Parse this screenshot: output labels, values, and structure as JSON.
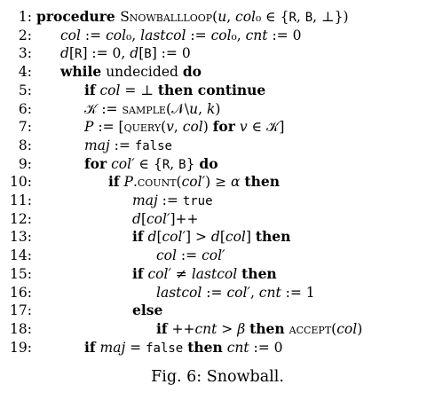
{
  "algorithm": {
    "lines": [
      {
        "num": "1:",
        "indent": 0,
        "segments": [
          {
            "t": "procedure ",
            "s": "kw"
          },
          {
            "t": "Snowballloop",
            "s": "sc"
          },
          {
            "t": "(",
            "s": ""
          },
          {
            "t": "u",
            "s": "it"
          },
          {
            "t": ", ",
            "s": ""
          },
          {
            "t": "col",
            "s": "it"
          },
          {
            "t": "₀ ∈ {",
            "s": ""
          },
          {
            "t": "R",
            "s": "tt"
          },
          {
            "t": ", ",
            "s": ""
          },
          {
            "t": "B",
            "s": "tt"
          },
          {
            "t": ", ⊥})",
            "s": ""
          }
        ]
      },
      {
        "num": "2:",
        "indent": 1,
        "segments": [
          {
            "t": "col",
            "s": "it"
          },
          {
            "t": " := ",
            "s": ""
          },
          {
            "t": "col",
            "s": "it"
          },
          {
            "t": "₀, ",
            "s": ""
          },
          {
            "t": "lastcol",
            "s": "it"
          },
          {
            "t": " := ",
            "s": ""
          },
          {
            "t": "col",
            "s": "it"
          },
          {
            "t": "₀, ",
            "s": ""
          },
          {
            "t": "cnt",
            "s": "it"
          },
          {
            "t": " := 0",
            "s": ""
          }
        ]
      },
      {
        "num": "3:",
        "indent": 1,
        "segments": [
          {
            "t": "d",
            "s": "it"
          },
          {
            "t": "[",
            "s": ""
          },
          {
            "t": "R",
            "s": "tt"
          },
          {
            "t": "] := 0, ",
            "s": ""
          },
          {
            "t": "d",
            "s": "it"
          },
          {
            "t": "[",
            "s": ""
          },
          {
            "t": "B",
            "s": "tt"
          },
          {
            "t": "] := 0",
            "s": ""
          }
        ]
      },
      {
        "num": "4:",
        "indent": 1,
        "segments": [
          {
            "t": "while",
            "s": "kw"
          },
          {
            "t": " undecided ",
            "s": ""
          },
          {
            "t": "do",
            "s": "kw"
          }
        ]
      },
      {
        "num": "5:",
        "indent": 2,
        "segments": [
          {
            "t": "if",
            "s": "kw"
          },
          {
            "t": " ",
            "s": ""
          },
          {
            "t": "col",
            "s": "it"
          },
          {
            "t": " = ⊥ ",
            "s": ""
          },
          {
            "t": "then continue",
            "s": "kw"
          }
        ]
      },
      {
        "num": "6:",
        "indent": 2,
        "segments": [
          {
            "t": "𝒦",
            "s": ""
          },
          {
            "t": " := ",
            "s": ""
          },
          {
            "t": "sample",
            "s": "sc"
          },
          {
            "t": "(𝒩\\",
            "s": ""
          },
          {
            "t": "u",
            "s": "it"
          },
          {
            "t": ", ",
            "s": ""
          },
          {
            "t": "k",
            "s": "it"
          },
          {
            "t": ")",
            "s": ""
          }
        ]
      },
      {
        "num": "7:",
        "indent": 2,
        "segments": [
          {
            "t": "P",
            "s": "it"
          },
          {
            "t": " := [",
            "s": ""
          },
          {
            "t": "query",
            "s": "sc"
          },
          {
            "t": "(",
            "s": ""
          },
          {
            "t": "v",
            "s": "it"
          },
          {
            "t": ", ",
            "s": ""
          },
          {
            "t": "col",
            "s": "it"
          },
          {
            "t": ")   ",
            "s": ""
          },
          {
            "t": "for",
            "s": "kw"
          },
          {
            "t": " ",
            "s": ""
          },
          {
            "t": "v",
            "s": "it"
          },
          {
            "t": " ∈ 𝒦]",
            "s": ""
          }
        ]
      },
      {
        "num": "8:",
        "indent": 2,
        "segments": [
          {
            "t": "maj",
            "s": "it"
          },
          {
            "t": " := ",
            "s": ""
          },
          {
            "t": "false",
            "s": "tt"
          }
        ]
      },
      {
        "num": "9:",
        "indent": 2,
        "segments": [
          {
            "t": "for",
            "s": "kw"
          },
          {
            "t": " ",
            "s": ""
          },
          {
            "t": "col′",
            "s": "it"
          },
          {
            "t": " ∈ {",
            "s": ""
          },
          {
            "t": "R",
            "s": "tt"
          },
          {
            "t": ", ",
            "s": ""
          },
          {
            "t": "B",
            "s": "tt"
          },
          {
            "t": "} ",
            "s": ""
          },
          {
            "t": "do",
            "s": "kw"
          }
        ]
      },
      {
        "num": "10:",
        "indent": 3,
        "segments": [
          {
            "t": "if",
            "s": "kw"
          },
          {
            "t": " ",
            "s": ""
          },
          {
            "t": "P",
            "s": "it"
          },
          {
            "t": ".",
            "s": ""
          },
          {
            "t": "count",
            "s": "sc"
          },
          {
            "t": "(",
            "s": ""
          },
          {
            "t": "col′",
            "s": "it"
          },
          {
            "t": ") ≥ ",
            "s": ""
          },
          {
            "t": "α",
            "s": "it"
          },
          {
            "t": " ",
            "s": ""
          },
          {
            "t": "then",
            "s": "kw"
          }
        ]
      },
      {
        "num": "11:",
        "indent": 4,
        "segments": [
          {
            "t": "maj",
            "s": "it"
          },
          {
            "t": " := ",
            "s": ""
          },
          {
            "t": "true",
            "s": "tt"
          }
        ]
      },
      {
        "num": "12:",
        "indent": 4,
        "segments": [
          {
            "t": "d",
            "s": "it"
          },
          {
            "t": "[",
            "s": ""
          },
          {
            "t": "col′",
            "s": "it"
          },
          {
            "t": "]++",
            "s": ""
          }
        ]
      },
      {
        "num": "13:",
        "indent": 4,
        "segments": [
          {
            "t": "if",
            "s": "kw"
          },
          {
            "t": " ",
            "s": ""
          },
          {
            "t": "d",
            "s": "it"
          },
          {
            "t": "[",
            "s": ""
          },
          {
            "t": "col′",
            "s": "it"
          },
          {
            "t": "] > ",
            "s": ""
          },
          {
            "t": "d",
            "s": "it"
          },
          {
            "t": "[",
            "s": ""
          },
          {
            "t": "col",
            "s": "it"
          },
          {
            "t": "] ",
            "s": ""
          },
          {
            "t": "then",
            "s": "kw"
          }
        ]
      },
      {
        "num": "14:",
        "indent": 5,
        "segments": [
          {
            "t": "col",
            "s": "it"
          },
          {
            "t": " := ",
            "s": ""
          },
          {
            "t": "col′",
            "s": "it"
          }
        ]
      },
      {
        "num": "15:",
        "indent": 4,
        "segments": [
          {
            "t": "if",
            "s": "kw"
          },
          {
            "t": " ",
            "s": ""
          },
          {
            "t": "col′",
            "s": "it"
          },
          {
            "t": " ≠ ",
            "s": ""
          },
          {
            "t": "lastcol",
            "s": "it"
          },
          {
            "t": " ",
            "s": ""
          },
          {
            "t": "then",
            "s": "kw"
          }
        ]
      },
      {
        "num": "16:",
        "indent": 5,
        "segments": [
          {
            "t": "lastcol",
            "s": "it"
          },
          {
            "t": " := ",
            "s": ""
          },
          {
            "t": "col′",
            "s": "it"
          },
          {
            "t": ", ",
            "s": ""
          },
          {
            "t": "cnt",
            "s": "it"
          },
          {
            "t": " := 1",
            "s": ""
          }
        ]
      },
      {
        "num": "17:",
        "indent": 4,
        "segments": [
          {
            "t": "else",
            "s": "kw"
          }
        ]
      },
      {
        "num": "18:",
        "indent": 5,
        "segments": [
          {
            "t": "if",
            "s": "kw"
          },
          {
            "t": " ++",
            "s": ""
          },
          {
            "t": "cnt",
            "s": "it"
          },
          {
            "t": " > ",
            "s": ""
          },
          {
            "t": "β",
            "s": "it"
          },
          {
            "t": " ",
            "s": ""
          },
          {
            "t": "then",
            "s": "kw"
          },
          {
            "t": " ",
            "s": ""
          },
          {
            "t": "accept",
            "s": "sc"
          },
          {
            "t": "(",
            "s": ""
          },
          {
            "t": "col",
            "s": "it"
          },
          {
            "t": ")",
            "s": ""
          }
        ]
      },
      {
        "num": "19:",
        "indent": 2,
        "segments": [
          {
            "t": "if",
            "s": "kw"
          },
          {
            "t": " ",
            "s": ""
          },
          {
            "t": "maj",
            "s": "it"
          },
          {
            "t": " = ",
            "s": ""
          },
          {
            "t": "false",
            "s": "tt"
          },
          {
            "t": " ",
            "s": ""
          },
          {
            "t": "then",
            "s": "kw"
          },
          {
            "t": " ",
            "s": ""
          },
          {
            "t": "cnt",
            "s": "it"
          },
          {
            "t": " := 0",
            "s": ""
          }
        ]
      }
    ]
  },
  "caption": "Fig. 6: Snowball."
}
